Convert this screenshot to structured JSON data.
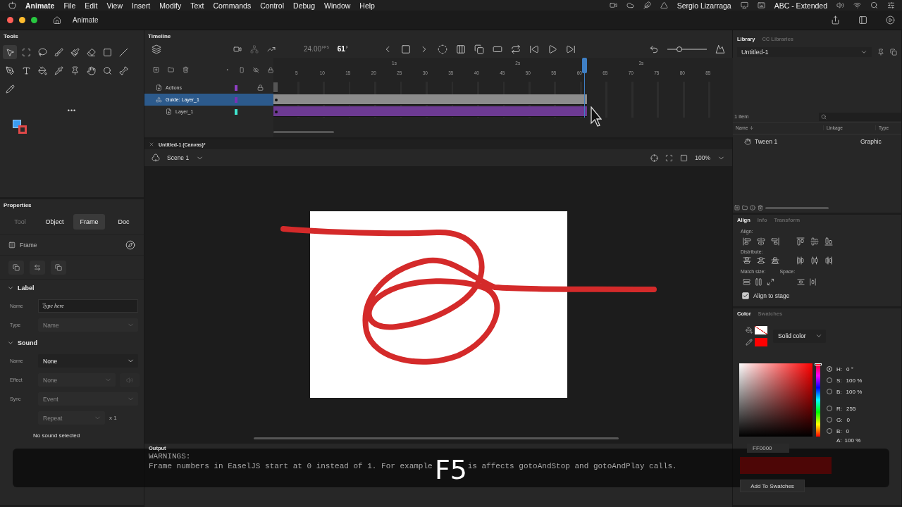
{
  "menu_bar": {
    "app": "Animate",
    "items": [
      "File",
      "Edit",
      "View",
      "Insert",
      "Modify",
      "Text",
      "Commands",
      "Control",
      "Debug",
      "Window",
      "Help"
    ],
    "user": "Sergio Lizarraga",
    "input_source": "ABC - Extended"
  },
  "title_bar": {
    "tab": "Animate"
  },
  "tools": {
    "title": "Tools",
    "more": "•••"
  },
  "properties": {
    "title": "Properties",
    "tabs": [
      {
        "label": "Tool",
        "selected": false,
        "disabled": true
      },
      {
        "label": "Object",
        "selected": false,
        "disabled": false
      },
      {
        "label": "Frame",
        "selected": true,
        "disabled": false
      },
      {
        "label": "Doc",
        "selected": false,
        "disabled": false
      }
    ],
    "header": "Frame",
    "sections": [
      {
        "title": "Label",
        "expanded": true,
        "fields": [
          {
            "label": "Name",
            "kind": "input",
            "placeholder": "Type here"
          },
          {
            "label": "Type",
            "kind": "select",
            "value": "Name",
            "disabled": true
          }
        ]
      },
      {
        "title": "Sound",
        "expanded": true,
        "fields": [
          {
            "label": "Name",
            "kind": "select",
            "value": "None",
            "disabled": false
          },
          {
            "label": "Effect",
            "kind": "select_edit",
            "value": "None",
            "disabled": true
          },
          {
            "label": "Sync",
            "kind": "select",
            "value": "Event",
            "disabled": true
          },
          {
            "kind": "repeat",
            "value": "Repeat",
            "suffix": "x 1",
            "disabled": true
          }
        ],
        "note": "No sound selected"
      }
    ]
  },
  "timeline": {
    "title": "Timeline",
    "fps": "24.00",
    "fps_unit": "FPS",
    "frame": "61",
    "frame_unit": "F",
    "scale": {
      "level": 0.3
    },
    "seconds": [
      "1s",
      "2s",
      "3s"
    ],
    "frame_ticks": [
      "5",
      "10",
      "15",
      "20",
      "25",
      "30",
      "35",
      "40",
      "45",
      "50",
      "55",
      "60",
      "65",
      "70",
      "75",
      "80",
      "85"
    ],
    "layers": [
      {
        "name": "Actions",
        "kind": "actions",
        "color": "#8f3fc4",
        "locked": true,
        "selected": false
      },
      {
        "name": "Guide: Layer_1",
        "kind": "guide",
        "color": "#7b2fb5",
        "locked": false,
        "selected": true,
        "children": [
          {
            "name": "Layer_1",
            "kind": "tweened",
            "color": "#3fe6cf",
            "locked": false,
            "selected": false
          }
        ]
      }
    ]
  },
  "document": {
    "tab": "Untitled-1 (Canvas)*",
    "scene": "Scene 1",
    "zoom": "100%"
  },
  "output": {
    "title": "Output",
    "lines": [
      "WARNINGS:"
    ],
    "message_start": "Frame numbers in EaselJS start at 0 instead of 1. For example",
    "message_end": "is affects gotoAndStop and gotoAndPlay calls."
  },
  "caption": "F5",
  "library": {
    "tabs": [
      {
        "label": "Library",
        "selected": true
      },
      {
        "label": "CC Libraries",
        "selected": false
      }
    ],
    "document": "Untitled-1",
    "count": "1 item",
    "columns": [
      "Name",
      "Linkage",
      "Type"
    ],
    "items": [
      {
        "name": "Tween 1",
        "type": "Graphic"
      }
    ]
  },
  "align": {
    "tabs": [
      {
        "label": "Align",
        "selected": true
      },
      {
        "label": "Info",
        "selected": false
      },
      {
        "label": "Transform",
        "selected": false
      }
    ],
    "align_label": "Align:",
    "distribute_label": "Distribute:",
    "match_label": "Match size:",
    "space_label": "Space:",
    "to_stage": {
      "label": "Align to stage",
      "checked": true
    }
  },
  "color": {
    "tabs": [
      {
        "label": "Color",
        "selected": true
      },
      {
        "label": "Swatches",
        "selected": false
      }
    ],
    "fill_type": "Solid color",
    "hue_slider": {
      "level": 0
    },
    "values": [
      {
        "label": "H:",
        "value": "0 °",
        "selected": true
      },
      {
        "label": "S:",
        "value": "100 %",
        "selected": false
      },
      {
        "label": "B:",
        "value": "100 %",
        "selected": false
      },
      {
        "label": "R:",
        "value": "255",
        "selected": false
      },
      {
        "label": "G:",
        "value": "0",
        "selected": false
      },
      {
        "label": "B:",
        "value": "0",
        "selected": false
      }
    ],
    "alpha": {
      "label": "A:",
      "value": "100 %"
    },
    "hex": "FF0000",
    "button": "Add To Swatches"
  }
}
